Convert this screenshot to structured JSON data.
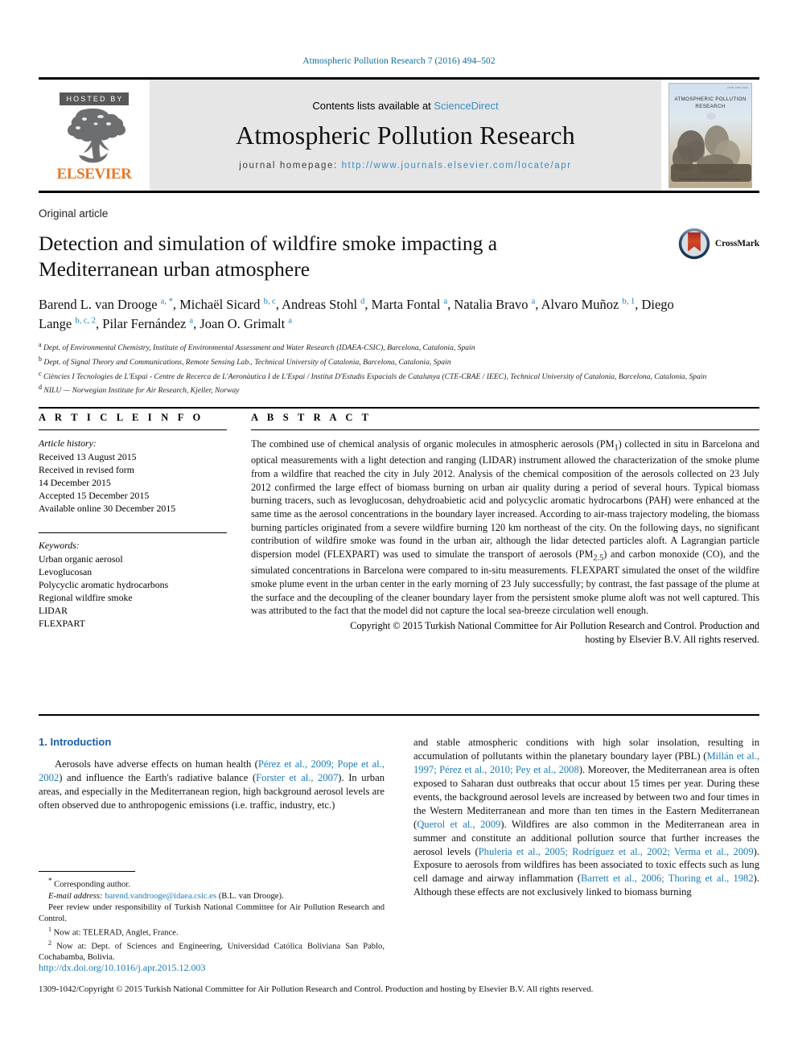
{
  "running_head": "Atmospheric Pollution Research 7 (2016) 494–502",
  "masthead": {
    "hosted_by": "HOSTED BY",
    "publisher": "ELSEVIER",
    "contents_prefix": "Contents lists available at ",
    "contents_link": "ScienceDirect",
    "journal_title": "Atmospheric Pollution Research",
    "homepage_prefix": "journal homepage: ",
    "homepage_url": "http://www.journals.elsevier.com/locate/apr",
    "cover": {
      "title_line1": "ATMOSPHERIC POLLUTION",
      "title_line2": "RESEARCH",
      "band": "ISSN 1309-1042",
      "foot": "Available online at www.sciencedirect.com"
    }
  },
  "article": {
    "type": "Original article",
    "crossmark_label": "CrossMark",
    "title": "Detection and simulation of wildfire smoke impacting a Mediterranean urban atmosphere",
    "authors": [
      {
        "name": "Barend L. van Drooge",
        "marks": "a, *"
      },
      {
        "name": "Michaël Sicard",
        "marks": "b, c"
      },
      {
        "name": "Andreas Stohl",
        "marks": "d"
      },
      {
        "name": "Marta Fontal",
        "marks": "a"
      },
      {
        "name": "Natalia Bravo",
        "marks": "a"
      },
      {
        "name": "Alvaro Muñoz",
        "marks": "b, 1"
      },
      {
        "name": "Diego Lange",
        "marks": "b, c, 2"
      },
      {
        "name": "Pilar Fernández",
        "marks": "a"
      },
      {
        "name": "Joan O. Grimalt",
        "marks": "a"
      }
    ],
    "affiliations": [
      {
        "mark": "a",
        "text": "Dept. of Environmental Chemistry, Institute of Environmental Assessment and Water Research (IDAEA-CSIC), Barcelona, Catalonia, Spain"
      },
      {
        "mark": "b",
        "text": "Dept. of Signal Theory and Communications, Remote Sensing Lab., Technical University of Catalonia, Barcelona, Catalonia, Spain"
      },
      {
        "mark": "c",
        "text": "Ciències I Tecnologies de L'Espai - Centre de Recerca de L'Aeronàutica I de L'Espai / Institut D'Estudis Espacials de Catalunya (CTE-CRAE / IEEC), Technical University of Catalonia, Barcelona, Catalonia, Spain"
      },
      {
        "mark": "d",
        "text": "NILU — Norwegian Institute for Air Research, Kjeller, Norway"
      }
    ]
  },
  "article_info": {
    "heading": "A R T I C L E  I N F O",
    "history_label": "Article history:",
    "history": [
      "Received 13 August 2015",
      "Received in revised form",
      "14 December 2015",
      "Accepted 15 December 2015",
      "Available online 30 December 2015"
    ],
    "keywords_label": "Keywords:",
    "keywords": [
      "Urban organic aerosol",
      "Levoglucosan",
      "Polycyclic aromatic hydrocarbons",
      "Regional wildfire smoke",
      "LIDAR",
      "FLEXPART"
    ]
  },
  "abstract": {
    "heading": "A B S T R A C T",
    "body": "The combined use of chemical analysis of organic molecules in atmospheric aerosols (PM1) collected in situ in Barcelona and optical measurements with a light detection and ranging (LIDAR) instrument allowed the characterization of the smoke plume from a wildfire that reached the city in July 2012. Analysis of the chemical composition of the aerosols collected on 23 July 2012 confirmed the large effect of biomass burning on urban air quality during a period of several hours. Typical biomass burning tracers, such as levoglucosan, dehydroabietic acid and polycyclic aromatic hydrocarbons (PAH) were enhanced at the same time as the aerosol concentrations in the boundary layer increased. According to air-mass trajectory modeling, the biomass burning particles originated from a severe wildfire burning 120 km northeast of the city. On the following days, no significant contribution of wildfire smoke was found in the urban air, although the lidar detected particles aloft. A Lagrangian particle dispersion model (FLEXPART) was used to simulate the transport of aerosols (PM2.5) and carbon monoxide (CO), and the simulated concentrations in Barcelona were compared to in-situ measurements. FLEXPART simulated the onset of the wildfire smoke plume event in the urban center in the early morning of 23 July successfully; by contrast, the fast passage of the plume at the surface and the decoupling of the cleaner boundary layer from the persistent smoke plume aloft was not well captured. This was attributed to the fact that the model did not capture the local sea-breeze circulation well enough.",
    "copyright_line1": "Copyright © 2015 Turkish National Committee for Air Pollution Research and Control. Production and",
    "copyright_line2": "hosting by Elsevier B.V. All rights reserved."
  },
  "introduction": {
    "number": "1.",
    "title": "Introduction",
    "left_paragraph": {
      "t1": "Aerosols have adverse effects on human health (",
      "c1": "Pérez et al., 2009; Pope et al., 2002",
      "t2": ") and influence the Earth's radiative balance (",
      "c2": "Forster et al., 2007",
      "t3": "). In urban areas, and especially in the Mediterranean region, high background aerosol levels are often observed due to anthropogenic emissions (i.e. traffic, industry, etc.)"
    },
    "right_paragraph": {
      "t1": "and stable atmospheric conditions with high solar insolation, resulting in accumulation of pollutants within the planetary boundary layer (PBL) (",
      "c1": "Millán et al., 1997; Pérez et al., 2010; Pey et al., 2008",
      "t2": "). Moreover, the Mediterranean area is often exposed to Saharan dust outbreaks that occur about 15 times per year. During these events, the background aerosol levels are increased by between two and four times in the Western Mediterranean and more than ten times in the Eastern Mediterranean (",
      "c2": "Querol et al., 2009",
      "t3": "). Wildfires are also common in the Mediterranean area in summer and constitute an additional pollution source that further increases the aerosol levels (",
      "c3": "Phuleria et al., 2005; Rodríguez et al., 2002; Verma et al., 2009",
      "t4": "). Exposure to aerosols from wildfires has been associated to toxic effects such as lung cell damage and airway inflammation (",
      "c4": "Barrett et al., 2006; Thoring et al., 1982",
      "t5": "). Although these effects are not exclusively linked to biomass burning"
    }
  },
  "footnotes": {
    "corresponding": "Corresponding author.",
    "email_label": "E-mail address:",
    "email": "barend.vandrooge@idaea.csic.es",
    "email_suffix": "(B.L. van Drooge).",
    "peer_review": "Peer review under responsibility of Turkish National Committee for Air Pollution Research and Control.",
    "note1_mark": "1",
    "note1": "Now at: TELERAD, Anglet, France.",
    "note2_mark": "2",
    "note2": "Now at: Dept. of Sciences and Engineering, Universidad Católica Boliviana San Pablo, Cochabamba, Bolivia."
  },
  "footer": {
    "doi": "http://dx.doi.org/10.1016/j.apr.2015.12.003",
    "issn_line": "1309-1042/Copyright © 2015 Turkish National Committee for Air Pollution Research and Control. Production and hosting by Elsevier B.V. All rights reserved."
  },
  "colors": {
    "link": "#1a7bb9",
    "running_head": "#0b6c9a",
    "section_title": "#1a5fa8",
    "elsevier_orange": "#e87722",
    "masthead_bg": "#e6e6e6"
  }
}
